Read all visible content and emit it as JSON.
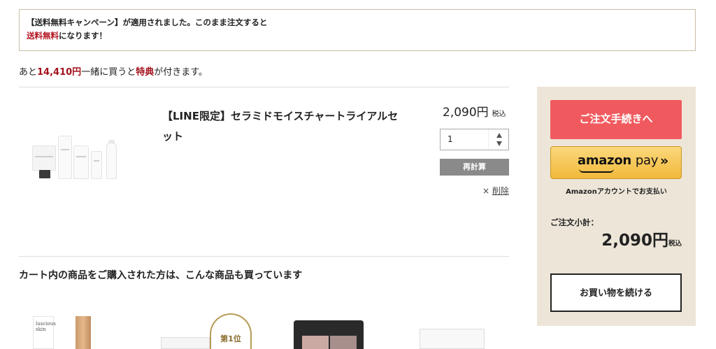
{
  "notice": {
    "line1": "【送料無料キャンペーン】が適用されました。このまま注文すると",
    "line2_em": "送料無料",
    "line2_rest": "になります！"
  },
  "remaining": {
    "prefix": "あと",
    "amount": "14,410円",
    "mid": "一緒に買うと",
    "benefit": "特典",
    "suffix": "が付きます。"
  },
  "cart_item": {
    "name": "【LINE限定】セラミドモイスチャートライアルセット",
    "price": "2,090円",
    "tax_label": "税込",
    "quantity": "1",
    "recalc_label": "再計算",
    "delete_mark": "×",
    "delete_label": "削除"
  },
  "recommend": {
    "title": "カート内の商品をご購入された方は、こんな商品も買っています",
    "thumb1_text": "luscious skin",
    "thumb2_badge": "第1位"
  },
  "summary": {
    "order_button": "ご注文手続きへ",
    "amazon_brand": "amazon",
    "amazon_pay": "pay",
    "amazon_chevron": "»",
    "amazon_note": "Amazonアカウントでお支払い",
    "subtotal_label": "ご注文小計：",
    "subtotal_value": "2,090円",
    "subtotal_tax": "税込",
    "continue_button": "お買い物を続ける"
  },
  "colors": {
    "accent_red": "#b3141f",
    "order_button": "#f05a5e",
    "panel_bg": "#ede6d8",
    "amazon_yellow": "#f2b93a"
  }
}
